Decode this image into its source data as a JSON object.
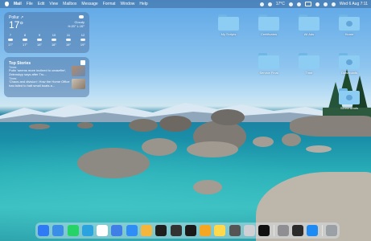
{
  "menubar": {
    "app_name": "Mail",
    "menus": [
      "File",
      "Edit",
      "View",
      "Mailbox",
      "Message",
      "Format",
      "Window",
      "Help"
    ],
    "status": {
      "temp": "17°C",
      "clock": "Wed 6 Aug 7:11"
    }
  },
  "weather": {
    "location": "Pollur ↗",
    "temp": "17°",
    "condition": "Cloudy",
    "hilo": "H:20° L:15°",
    "forecast": [
      {
        "time": "7",
        "temp": "17°"
      },
      {
        "time": "8",
        "temp": "17°"
      },
      {
        "time": "9",
        "temp": "18°"
      },
      {
        "time": "10",
        "temp": "18°"
      },
      {
        "time": "11",
        "temp": "19°"
      },
      {
        "time": "12",
        "temp": "19°"
      }
    ]
  },
  "news": {
    "title": "Top Stories",
    "items": [
      {
        "source": "Times",
        "headline": "Putin 'seems more inclined to ceasefire', Zelenskyy says after Tru..."
      },
      {
        "source": "Times",
        "headline": "'Chaos and division': How the Home Office has failed to halt small boats a..."
      }
    ]
  },
  "desktop_icons": [
    {
      "label": "My Scripts"
    },
    {
      "label": "Certificates"
    },
    {
      "label": "All Ads"
    },
    {
      "label": "Home"
    },
    {
      "label": "Service Final"
    },
    {
      "label": "Time"
    },
    {
      "label": "Downloads"
    },
    {
      "label": "Screenshots"
    }
  ],
  "dock": {
    "apps": [
      "Finder",
      "Launchpad",
      "WhatsApp",
      "Telegram",
      "Calendar",
      "Mail",
      "Safari",
      "Photos",
      "Chrome",
      "Terminal",
      "Apple TV",
      "Pages",
      "Notes",
      "Calculator",
      "Screenshot",
      "ChatGPT",
      "Settings",
      "Activity Monitor",
      "App Store",
      "Trash"
    ],
    "colors": [
      "#2f7bf5",
      "#3a8ee8",
      "#25d366",
      "#2aa3df",
      "#ffffff",
      "#3f7fe6",
      "#2e8ef5",
      "#f4b63c",
      "#1f1f1f",
      "#333333",
      "#1a1a1a",
      "#f5a623",
      "#ffd84c",
      "#555555",
      "#cfcfd4",
      "#111111",
      "#8e8e93",
      "#2b2b2b",
      "#1d8bf3",
      "#9aa0a6"
    ]
  }
}
